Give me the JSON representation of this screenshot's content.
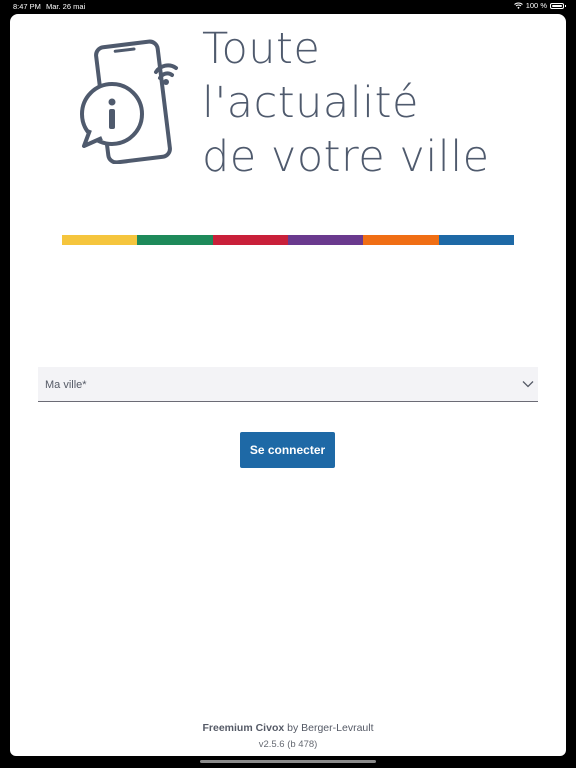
{
  "status_bar": {
    "time": "8:47 PM",
    "date": "Mar. 26 mai",
    "battery": "100 %",
    "wifi_icon": "wifi-icon",
    "battery_icon": "battery-icon"
  },
  "hero": {
    "icon": "phone-info-notification-icon",
    "tagline_lines": [
      "Toute",
      "l'actualité",
      "de votre ville"
    ],
    "text_color": "#4f5a6d"
  },
  "color_bar": {
    "colors": [
      "#f5c53d",
      "#1e8a5a",
      "#c9203a",
      "#6a3a8e",
      "#f06e14",
      "#1e69a6"
    ]
  },
  "form": {
    "city_select": {
      "label": "Ma ville*",
      "icon": "chevron-down-icon"
    },
    "connect_label": "Se connecter",
    "accent_color": "#1e69a6"
  },
  "footer": {
    "product": "Freemium Civox",
    "by_text": " by Berger-Levrault",
    "version": "v2.5.6 (b 478)"
  }
}
